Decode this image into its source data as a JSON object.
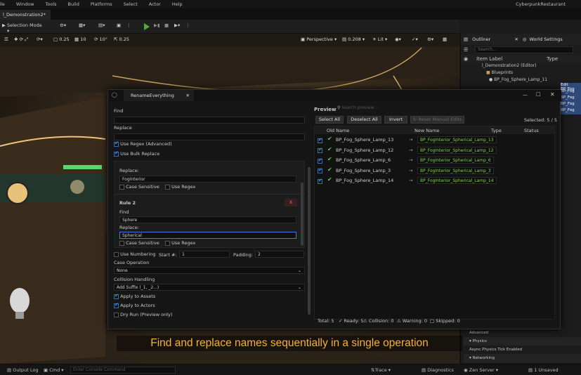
{
  "menu": [
    "File",
    "Window",
    "Tools",
    "Build",
    "Platforms",
    "Select",
    "Actor",
    "Help"
  ],
  "project_name": "CyberpunkRestaurant",
  "level_tab": "l_Demonstration2*",
  "toolbar": {
    "selection_mode": "Selection Mode"
  },
  "viewport": {
    "perspective": "Perspective",
    "speed": "0.208",
    "lit": "Lit",
    "grid": "10",
    "angle": "10°",
    "scale": "0.25"
  },
  "outliner": {
    "tab": "Outliner",
    "world_settings": "World Settings",
    "search_placeholder": "Search...",
    "col_label": "Item Label",
    "col_type": "Type",
    "rows": [
      "l_Demonstration2 (Editor)",
      "Blueprints",
      "BP_Fog_Sphere_Lamp_11"
    ],
    "side_labels": [
      "Edit BP_Fog",
      "BP_Fog",
      "BP_Fog",
      "BP_Fog",
      "BP_Fog"
    ],
    "details": [
      "Advanced",
      "Physics",
      "Async Physics Tick Enabled",
      "Networking"
    ],
    "zen": "Zen Server",
    "unsaved": "1 Unsaved"
  },
  "dialog": {
    "title": "RenameEverything",
    "find_label": "Find",
    "replace_label": "Replace",
    "use_regex": "Use Regex (Advanced)",
    "use_bulk": "Use Bulk Replace",
    "rule1": {
      "replace_label": "Replace:",
      "replace_value": "FogInterior",
      "case": "Case Sensitive",
      "regex": "Use Regex"
    },
    "rule2": {
      "title": "Rule 2",
      "remove": "X",
      "find_label": "Find",
      "find_value": "Sphere",
      "replace_label": "Replace:",
      "replace_value": "Spherical",
      "case": "Case Sensitive",
      "regex": "Use Regex"
    },
    "use_numbering": "Use Numbering",
    "start_label": "Start #:",
    "start_value": "1",
    "padding_label": "Padding:",
    "padding_value": "2",
    "case_op_label": "Case Operation",
    "case_op_value": "None",
    "collision_label": "Collision Handling",
    "collision_value": "Add Suffix (_1, _2...)",
    "apply_assets": "Apply to Assets",
    "apply_actors": "Apply to Actors",
    "dry_run": "Dry Run (Preview only)",
    "preview_label": "Preview",
    "search_placeholder": "Search preview...",
    "select_all": "Select All",
    "deselect_all": "Deselect All",
    "invert": "Invert",
    "reset_edits": "Reset Manual Edits",
    "selected": "Selected: 5 / 5",
    "cols": {
      "old": "Old Name",
      "new": "New Name",
      "type": "Type",
      "status": "Status"
    },
    "rows": [
      {
        "old": "BP_Fog_Sphere_Lamp_13",
        "new": "BP_FogInterior_Spherical_Lamp_13"
      },
      {
        "old": "BP_Fog_Sphere_Lamp_12",
        "new": "BP_FogInterior_Spherical_Lamp_12"
      },
      {
        "old": "BP_Fog_Sphere_Lamp_6",
        "new": "BP_FogInterior_Spherical_Lamp_6"
      },
      {
        "old": "BP_Fog_Sphere_Lamp_3",
        "new": "BP_FogInterior_Spherical_Lamp_3"
      },
      {
        "old": "BP_Fog_Sphere_Lamp_14",
        "new": "BP_FogInterior_Spherical_Lamp_14"
      }
    ],
    "footer": {
      "total": "Total: 5",
      "ready": "Ready: 5",
      "collision": "Collision: 0",
      "warning": "Warning: 0",
      "skipped": "Skipped: 0"
    }
  },
  "caption": "Find and replace names sequentially in a single operation",
  "statusbar": {
    "output_log": "Output Log",
    "cmd": "Cmd",
    "console_placeholder": "Enter Console Command",
    "trace": "Trace",
    "diagnostics": "Diagnostics"
  },
  "colors": {
    "accent": "#3f7fd2",
    "new_name": "#7cdc4c",
    "caption": "#f5b133"
  }
}
